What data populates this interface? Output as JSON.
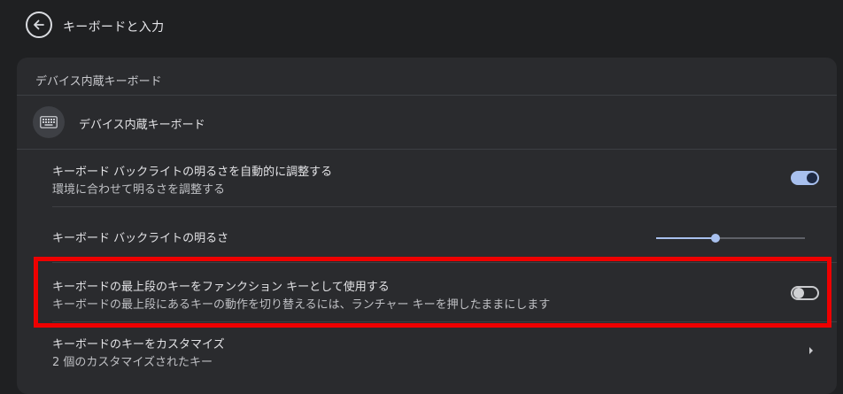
{
  "header": {
    "title": "キーボードと入力"
  },
  "section": {
    "title": "デバイス内蔵キーボード"
  },
  "device": {
    "label": "デバイス内蔵キーボード"
  },
  "rows": {
    "auto_backlight": {
      "title": "キーボード バックライトの明るさを自動的に調整する",
      "subtitle": "環境に合わせて明るさを調整する",
      "enabled": true
    },
    "backlight_brightness": {
      "title": "キーボード バックライトの明るさ",
      "value": 0.4
    },
    "function_keys": {
      "title": "キーボードの最上段のキーをファンクション キーとして使用する",
      "subtitle": "キーボードの最上段にあるキーの動作を切り替えるには、ランチャー キーを押したままにします",
      "enabled": false
    },
    "customize_keys": {
      "title": "キーボードのキーをカスタマイズ",
      "subtitle": "2 個のカスタマイズされたキー"
    }
  },
  "colors": {
    "accent": "#a8c0ee",
    "highlight": "#ee0000",
    "card": "#2a2b2e",
    "background": "#1f2022"
  },
  "icons": {
    "back": "arrow-left-circle-icon",
    "keyboard": "keyboard-icon",
    "chevron": "chevron-right-icon"
  }
}
